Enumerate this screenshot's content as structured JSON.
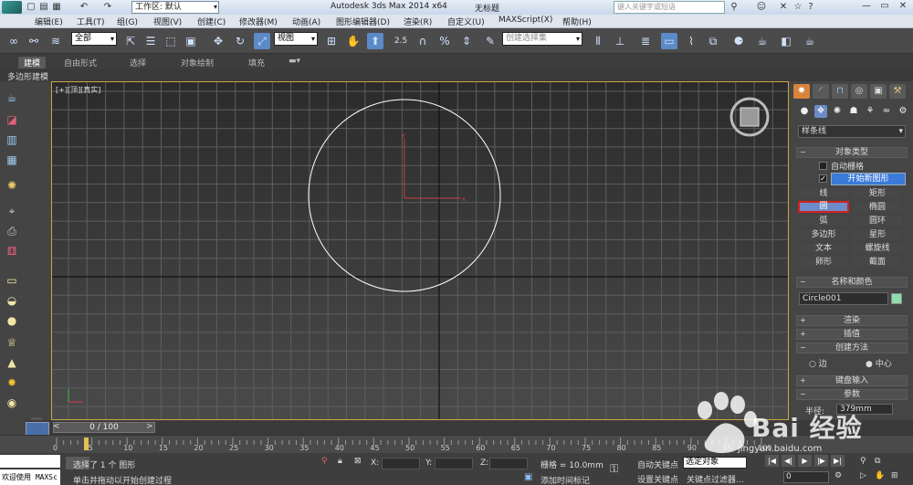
{
  "titlebar": {
    "workspace_label": "工作区: 默认",
    "app_title": "Autodesk 3ds Max  2014 x64",
    "doc_title": "无标题",
    "search_placeholder": "键入关键字或短语"
  },
  "menu": [
    "编辑(E)",
    "工具(T)",
    "组(G)",
    "视图(V)",
    "创建(C)",
    "修改器(M)",
    "动画(A)",
    "图形编辑器(D)",
    "渲染(R)",
    "自定义(U)",
    "MAXScript(X)",
    "帮助(H)"
  ],
  "toolbar": {
    "selection_filter": "全部",
    "ref_coord": "视图",
    "snap_value": "2.5",
    "named_selection": "创建选择集"
  },
  "ribbon": {
    "tabs": [
      "建模",
      "自由形式",
      "选择",
      "对象绘制",
      "填充"
    ],
    "active_tab": "建模",
    "sub_label": "多边形建模"
  },
  "viewport": {
    "label": "[+][顶][真实]"
  },
  "command_panel": {
    "category": "样条线",
    "object_type": {
      "title": "对象类型",
      "autogrid_label": "自动栅格",
      "start_new_shape_label": "开始新图形",
      "buttons": [
        "线",
        "矩形",
        "圆",
        "椭圆",
        "弧",
        "圆环",
        "多边形",
        "星形",
        "文本",
        "螺旋线",
        "卵形",
        "截面"
      ],
      "selected": "圆"
    },
    "name_color": {
      "title": "名称和颜色",
      "name_value": "Circle001",
      "color": "#8fdcae"
    },
    "rollouts": [
      "渲染",
      "插值",
      "创建方法",
      "键盘输入",
      "参数"
    ],
    "creation_method": {
      "edge_label": "边",
      "center_label": "中心"
    },
    "param_radius_label": "半径:",
    "param_radius_value": "379mm"
  },
  "timeline": {
    "frame_readout": "0 / 100",
    "ticks": [
      "0",
      "5",
      "10",
      "15",
      "20",
      "25",
      "30",
      "35",
      "40",
      "45",
      "50",
      "55",
      "60",
      "65",
      "70",
      "75",
      "80",
      "85",
      "90",
      "95",
      "100"
    ]
  },
  "status": {
    "maxscript_text": "欢迎使用 MAXSc",
    "selection_info": "选择了 1 个 图形",
    "prompt": "单击并拖动以开始创建过程",
    "x_label": "X:",
    "y_label": "Y:",
    "z_label": "Z:",
    "grid_label": "栅格 = 10.0mm",
    "add_time_tag": "添加时间标记",
    "auto_key": "自动关键点",
    "set_key": "设置关键点",
    "key_mode": "选定对象",
    "key_filters": "关键点过滤器...",
    "frame_field": "0"
  },
  "watermark": {
    "brand": "Bai  经验",
    "url": "jingyan.baidu.com"
  },
  "colors": {
    "viewport_border": "#c8a848",
    "selected_button": "#6c8cc8",
    "highlight_red": "#d62020",
    "circle_stroke": "#ffffff"
  }
}
